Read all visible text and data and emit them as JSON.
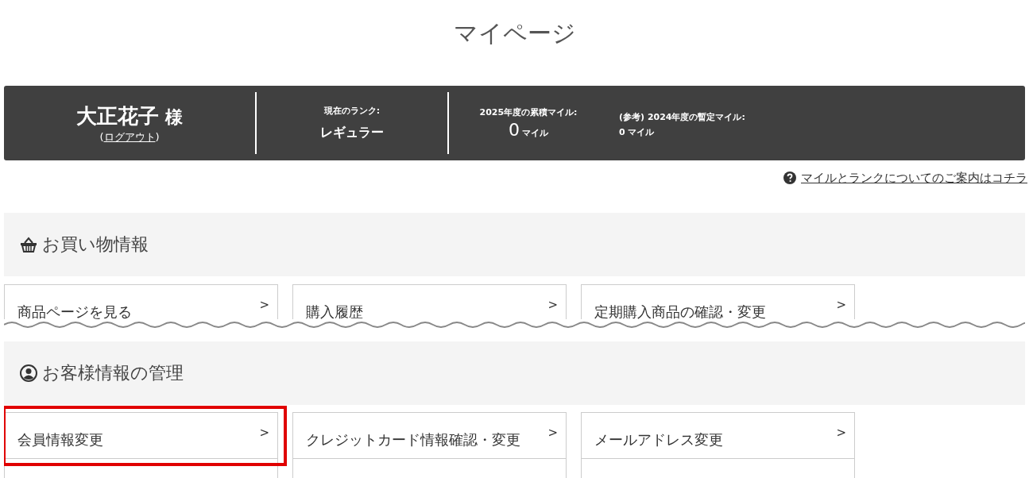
{
  "page_title": "マイページ",
  "member_panel": {
    "name": "大正花子",
    "honorific": "様",
    "logout": {
      "before": "(",
      "label": "ログアウト",
      "after": ")"
    },
    "rank": {
      "label": "現在のランク:",
      "value": "レギュラー"
    },
    "miles": {
      "label": "2025年度の累積マイル:",
      "value": "0",
      "unit": "マイル"
    },
    "reference": {
      "label": "(参考) 2024年度の暫定マイル:",
      "value": "0 マイル"
    }
  },
  "help_link": "マイルとランクについてのご案内はコチラ",
  "sections": [
    {
      "title": "お買い物情報",
      "kind": "shopping",
      "cut_below": true,
      "cards": [
        {
          "label": "商品ページを見る",
          "chevron": ">",
          "highlighted": false
        },
        {
          "label": "購入履歴",
          "chevron": ">",
          "highlighted": false
        },
        {
          "label": "定期購入商品の確認・変更",
          "chevron": ">",
          "highlighted": false
        }
      ]
    },
    {
      "title": "お客様情報の管理",
      "kind": "account",
      "cards": [
        {
          "label": "会員情報変更",
          "chevron": ">",
          "highlighted": true
        },
        {
          "label": "クレジットカード情報確認・変更",
          "chevron": ">",
          "highlighted": false
        },
        {
          "label": "メールアドレス変更",
          "chevron": ">",
          "highlighted": false
        }
      ]
    }
  ]
}
